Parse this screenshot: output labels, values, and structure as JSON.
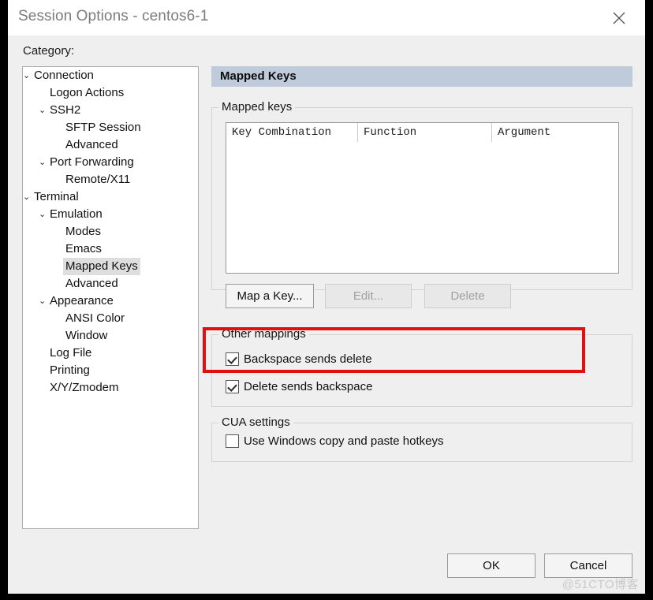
{
  "window": {
    "title": "Session Options - centos6-1",
    "close_icon": "close-icon"
  },
  "sidebar": {
    "label": "Category:",
    "items": [
      {
        "label": "Connection",
        "indent": 0,
        "chevron": "⌄",
        "selected": false
      },
      {
        "label": "Logon Actions",
        "indent": 1,
        "chevron": "",
        "selected": false
      },
      {
        "label": "SSH2",
        "indent": 1,
        "chevron": "⌄",
        "selected": false
      },
      {
        "label": "SFTP Session",
        "indent": 2,
        "chevron": "",
        "selected": false
      },
      {
        "label": "Advanced",
        "indent": 2,
        "chevron": "",
        "selected": false
      },
      {
        "label": "Port Forwarding",
        "indent": 1,
        "chevron": "⌄",
        "selected": false
      },
      {
        "label": "Remote/X11",
        "indent": 2,
        "chevron": "",
        "selected": false
      },
      {
        "label": "Terminal",
        "indent": 0,
        "chevron": "⌄",
        "selected": false
      },
      {
        "label": "Emulation",
        "indent": 1,
        "chevron": "⌄",
        "selected": false
      },
      {
        "label": "Modes",
        "indent": 2,
        "chevron": "",
        "selected": false
      },
      {
        "label": "Emacs",
        "indent": 2,
        "chevron": "",
        "selected": false
      },
      {
        "label": "Mapped Keys",
        "indent": 2,
        "chevron": "",
        "selected": true
      },
      {
        "label": "Advanced",
        "indent": 2,
        "chevron": "",
        "selected": false
      },
      {
        "label": "Appearance",
        "indent": 1,
        "chevron": "⌄",
        "selected": false
      },
      {
        "label": "ANSI Color",
        "indent": 2,
        "chevron": "",
        "selected": false
      },
      {
        "label": "Window",
        "indent": 2,
        "chevron": "",
        "selected": false
      },
      {
        "label": "Log File",
        "indent": 1,
        "chevron": "",
        "selected": false
      },
      {
        "label": "Printing",
        "indent": 1,
        "chevron": "",
        "selected": false
      },
      {
        "label": "X/Y/Zmodem",
        "indent": 1,
        "chevron": "",
        "selected": false
      }
    ]
  },
  "pane": {
    "header": "Mapped Keys",
    "mapped_keys_group": {
      "title": "Mapped keys",
      "columns": [
        "Key Combination",
        "Function",
        "Argument"
      ],
      "rows": []
    },
    "buttons": {
      "map_a_key": {
        "label": "Map a Key...",
        "enabled": true
      },
      "edit": {
        "label": "Edit...",
        "enabled": false
      },
      "delete": {
        "label": "Delete",
        "enabled": false
      }
    },
    "other_mappings_group": {
      "title": "Other mappings",
      "checkboxes": [
        {
          "label": "Backspace sends delete",
          "checked": true
        },
        {
          "label": "Delete sends backspace",
          "checked": true
        }
      ]
    },
    "cua_group": {
      "title": "CUA settings",
      "checkboxes": [
        {
          "label": "Use Windows copy and paste hotkeys",
          "checked": false
        }
      ]
    }
  },
  "footer": {
    "ok": "OK",
    "cancel": "Cancel"
  },
  "annotation": {
    "highlight_color": "#e01010"
  },
  "watermark": "@51CTO博客"
}
